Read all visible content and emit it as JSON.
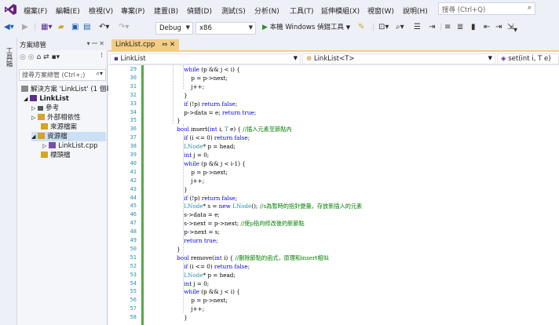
{
  "menu": {
    "items": [
      "檔案(F)",
      "編輯(E)",
      "檢視(V)",
      "專案(P)",
      "建置(B)",
      "偵錯(D)",
      "測試(S)",
      "分析(N)",
      "工具(T)",
      "延伸模組(X)",
      "視窗(W)",
      "說明(H)"
    ],
    "search_placeholder": "搜尋 (Ctrl+Q)"
  },
  "toolbar": {
    "config": "Debug",
    "platform": "x86",
    "run_label": "本機 Windows 偵錯工具"
  },
  "left_tab": {
    "label": "工具箱"
  },
  "solution_explorer": {
    "title": "方案總管",
    "search_placeholder": "搜尋方案總管 (Ctrl+;)",
    "tree": [
      {
        "label": "解決方案 'LinkList' (1 個專",
        "level": 0
      },
      {
        "label": "LinkList",
        "level": 1
      },
      {
        "label": "參考",
        "level": 2
      },
      {
        "label": "外部相依性",
        "level": 2
      },
      {
        "label": "來源檔案",
        "level": 2
      },
      {
        "label": "資源檔",
        "level": 2
      },
      {
        "label": "LinkList.cpp",
        "level": 3
      },
      {
        "label": "標頭檔",
        "level": 2
      }
    ]
  },
  "editor": {
    "tab_title": "LinkList.cpp",
    "tab_icons": "⇔ ✕",
    "nav_project": "LinkList",
    "nav_class": "LinkList<T>",
    "nav_member": "set(int i, T e)"
  },
  "code": {
    "line_numbers": [
      "29",
      "30",
      "31",
      "32",
      "33",
      "34",
      "35",
      "36",
      "37",
      "38",
      "39",
      "40",
      "41",
      "42",
      "43",
      "44",
      "45",
      "46",
      "47",
      "48",
      "49",
      "50",
      "51",
      "52",
      "53",
      "54",
      "55",
      "56",
      "57",
      "58"
    ],
    "lines": [
      "        while (p && j < i) {",
      "            p = p->next;",
      "            j++;",
      "        }",
      "        if (!p) return false;",
      "        p->data = e; return true;",
      "    }",
      "    bool insert(int i, T e) { //插入元素至節點內",
      "        if (i <= 0) return false;",
      "        LNode* p = head;",
      "        int j = 0;",
      "        while (p && j < i-1) {",
      "            p = p->next;",
      "            j++;",
      "        }",
      "        if (!p) return false;",
      "        LNode* s = new LNode(); //s為暫時的指針變量，存放新插入的元素",
      "        s->data = e;",
      "        s->next = p->next; //使p指向修改後的新節點",
      "        p->next = s;",
      "        return true;",
      "    }",
      "    bool remove(int i) { //刪除節點的函式，原理和insert相似",
      "        if (i <= 0) return false;",
      "        LNode* p = head;",
      "        int j = 0;",
      "        while (p && j < i) {",
      "            p = p->next;",
      "            j++;",
      "        }"
    ]
  }
}
